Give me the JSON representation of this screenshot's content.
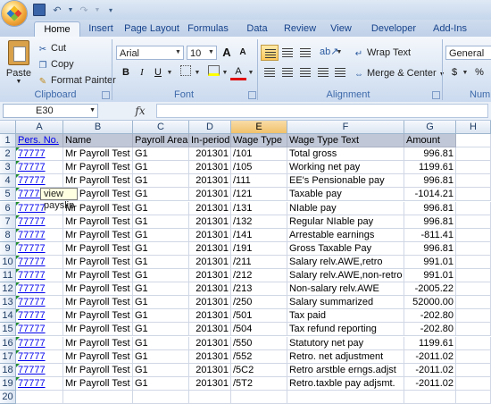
{
  "title_bar": {
    "quick_access": [
      "save-icon",
      "undo-icon",
      "redo-icon",
      "customize-icon"
    ]
  },
  "ribbon_tabs": [
    "Home",
    "Insert",
    "Page Layout",
    "Formulas",
    "Data",
    "Review",
    "View",
    "Developer",
    "Add-Ins"
  ],
  "ribbon": {
    "clipboard": {
      "paste": "Paste",
      "cut": "Cut",
      "copy": "Copy",
      "format_painter": "Format Painter",
      "label": "Clipboard"
    },
    "font": {
      "name": "Arial",
      "size": "10",
      "grow": "A",
      "shrink": "A",
      "bold": "B",
      "italic": "I",
      "underline": "U",
      "color_letter": "A",
      "label": "Font"
    },
    "alignment": {
      "wrap_text": "Wrap Text",
      "merge_center": "Merge & Center",
      "label": "Alignment"
    },
    "number": {
      "format": "General",
      "dollar": "$",
      "percent": "%",
      "label": "Numb"
    }
  },
  "formula_bar": {
    "name_box": "E30",
    "fx": "fx",
    "formula": ""
  },
  "sheet": {
    "columns": [
      "A",
      "B",
      "C",
      "D",
      "E",
      "F",
      "G",
      "H"
    ],
    "selected_column": "E",
    "rows": [
      "1",
      "2",
      "3",
      "4",
      "5",
      "6",
      "7",
      "8",
      "9",
      "10",
      "11",
      "12",
      "13",
      "14",
      "15",
      "16",
      "17",
      "18",
      "19",
      "20"
    ],
    "header": [
      "Pers. No.",
      "Name",
      "Payroll Area",
      "In-period",
      "Wage Type",
      "Wage Type  Text",
      "Amount"
    ],
    "data": [
      [
        "77777",
        "Mr Payroll Test",
        "G1",
        "201301",
        "/101",
        "Total gross",
        "996.81"
      ],
      [
        "77777",
        "Mr Payroll Test",
        "G1",
        "201301",
        "/105",
        "Working net pay",
        "1199.61"
      ],
      [
        "77777",
        "Mr Payroll Test",
        "G1",
        "201301",
        "/111",
        "EE's Pensionable pay",
        "996.81"
      ],
      [
        "77777",
        "Mr Payroll Test",
        "G1",
        "201301",
        "/121",
        "Taxable pay",
        "-1014.21"
      ],
      [
        "77777",
        "Mr Payroll Test",
        "G1",
        "201301",
        "/131",
        "NIable pay",
        "996.81"
      ],
      [
        "77777",
        "Mr Payroll Test",
        "G1",
        "201301",
        "/132",
        "Regular NIable pay",
        "996.81"
      ],
      [
        "77777",
        "Mr Payroll Test",
        "G1",
        "201301",
        "/141",
        "Arrestable earnings",
        "-811.41"
      ],
      [
        "77777",
        "Mr Payroll Test",
        "G1",
        "201301",
        "/191",
        "Gross Taxable Pay",
        "996.81"
      ],
      [
        "77777",
        "Mr Payroll Test",
        "G1",
        "201301",
        "/211",
        "Salary relv.AWE,retro",
        "991.01"
      ],
      [
        "77777",
        "Mr Payroll Test",
        "G1",
        "201301",
        "/212",
        "Salary relv.AWE,non-retro",
        "991.01"
      ],
      [
        "77777",
        "Mr Payroll Test",
        "G1",
        "201301",
        "/213",
        "Non-salary relv.AWE",
        "-2005.22"
      ],
      [
        "77777",
        "Mr Payroll Test",
        "G1",
        "201301",
        "/250",
        "Salary summarized",
        "52000.00"
      ],
      [
        "77777",
        "Mr Payroll Test",
        "G1",
        "201301",
        "/501",
        "Tax paid",
        "-202.80"
      ],
      [
        "77777",
        "Mr Payroll Test",
        "G1",
        "201301",
        "/504",
        "Tax refund reporting",
        "-202.80"
      ],
      [
        "77777",
        "Mr Payroll Test",
        "G1",
        "201301",
        "/550",
        "Statutory net pay",
        "1199.61"
      ],
      [
        "77777",
        "Mr Payroll Test",
        "G1",
        "201301",
        "/552",
        "Retro. net adjustment",
        "-2011.02"
      ],
      [
        "77777",
        "Mr Payroll Test",
        "G1",
        "201301",
        "/5C2",
        "Retro arstble erngs.adjst",
        "-2011.02"
      ],
      [
        "77777",
        "Mr Payroll Test",
        "G1",
        "201301",
        "/5T2",
        "Retro.taxble pay adjsmt.",
        "-2011.02"
      ]
    ],
    "tooltip": "view payslip",
    "header_fill": "#c0c7d6",
    "link_color": "#0000ee"
  }
}
